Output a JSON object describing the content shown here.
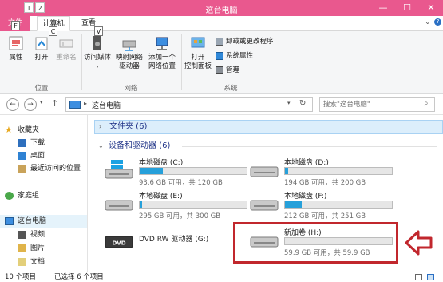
{
  "window": {
    "title": "这台电脑",
    "minimize": "—",
    "maximize": "☐",
    "close": "✕"
  },
  "qat": {
    "key1": "1",
    "key2": "2"
  },
  "ribbon_tabs": {
    "file": "文件",
    "file_key": "F",
    "computer": "计算机",
    "computer_key": "C",
    "view": "查看",
    "view_key": "V"
  },
  "ribbon": {
    "location": {
      "properties": "属性",
      "open": "打开",
      "rename": "重命名",
      "group": "位置"
    },
    "network": {
      "access_media": "访问媒体",
      "map_drive_1": "映射网络",
      "map_drive_2": "驱动器",
      "add_location_1": "添加一个",
      "add_location_2": "网络位置",
      "group": "网络"
    },
    "system": {
      "open_cp_1": "打开",
      "open_cp_2": "控制面板",
      "uninstall": "卸载或更改程序",
      "sys_props": "系统属性",
      "manage": "管理",
      "group": "系统"
    }
  },
  "address": {
    "path": "这台电脑",
    "search_placeholder": "搜索\"这台电脑\""
  },
  "nav": {
    "favorites": "收藏夹",
    "downloads": "下载",
    "desktop": "桌面",
    "recent": "最近访问的位置",
    "homegroup": "家庭组",
    "this_pc": "这台电脑",
    "videos": "视频",
    "pictures": "图片",
    "documents": "文档"
  },
  "content": {
    "folders_header": "文件夹 (6)",
    "drives_header": "设备和驱动器 (6)",
    "drives": [
      {
        "name": "本地磁盘 (C:)",
        "free": "93.6 GB 可用，共 120 GB",
        "used_fraction": 0.22
      },
      {
        "name": "本地磁盘 (D:)",
        "free": "194 GB 可用，共 200 GB",
        "used_fraction": 0.03
      },
      {
        "name": "本地磁盘 (E:)",
        "free": "295 GB 可用，共 300 GB",
        "used_fraction": 0.02
      },
      {
        "name": "本地磁盘 (F:)",
        "free": "212 GB 可用，共 251 GB",
        "used_fraction": 0.16
      },
      {
        "name": "DVD RW 驱动器 (G:)"
      },
      {
        "name": "新加卷 (H:)",
        "free": "59.9 GB 可用，共 59.9 GB",
        "used_fraction": 0.0
      }
    ],
    "dvd_label": "DVD"
  },
  "status": {
    "items": "10 个项目",
    "selected": "已选择 6 个项目"
  },
  "colors": {
    "accent": "#e9588e",
    "bar_fill": "#26a0da",
    "highlight": "#c1272d"
  }
}
